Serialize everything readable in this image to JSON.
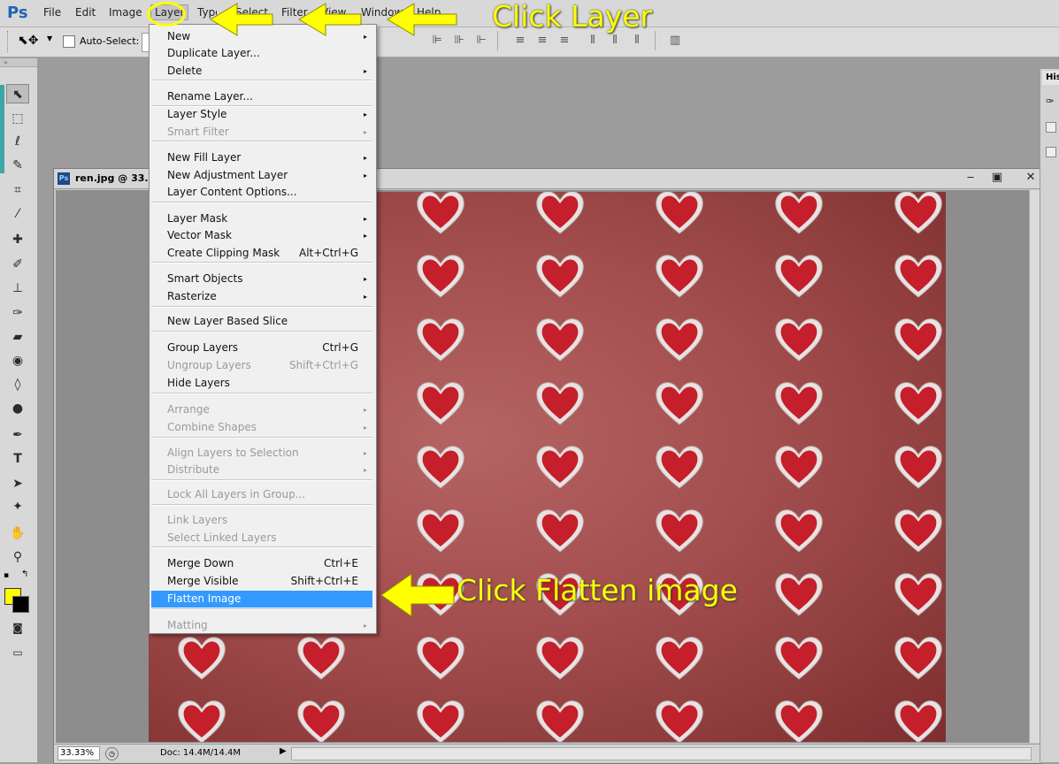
{
  "app": {
    "logo": "Ps"
  },
  "menubar": [
    "File",
    "Edit",
    "Image",
    "Layer",
    "Type",
    "Select",
    "Filter",
    "View",
    "Window",
    "Help"
  ],
  "options": {
    "auto_select": "Auto-Select:"
  },
  "document": {
    "title": "ren.jpg @ 33.3",
    "zoom": "33.33%",
    "doc_size": "Doc: 14.4M/14.4M"
  },
  "right_panel": {
    "tab": "His"
  },
  "layer_menu": {
    "items": [
      {
        "label": "New",
        "arrow": "▸",
        "disabled": false
      },
      {
        "label": "Duplicate Layer...",
        "disabled": false
      },
      {
        "label": "Delete",
        "arrow": "▸",
        "disabled": false
      },
      {
        "label": "Rename Layer...",
        "disabled": false
      },
      {
        "label": "Layer Style",
        "arrow": "▸",
        "disabled": false
      },
      {
        "label": "Smart Filter",
        "arrow": "▸",
        "disabled": true
      },
      {
        "label": "New Fill Layer",
        "arrow": "▸",
        "disabled": false
      },
      {
        "label": "New Adjustment Layer",
        "arrow": "▸",
        "disabled": false
      },
      {
        "label": "Layer Content Options...",
        "disabled": false
      },
      {
        "label": "Layer Mask",
        "arrow": "▸",
        "disabled": false
      },
      {
        "label": "Vector Mask",
        "arrow": "▸",
        "disabled": false
      },
      {
        "label": "Create Clipping Mask",
        "shortcut": "Alt+Ctrl+G",
        "disabled": false
      },
      {
        "label": "Smart Objects",
        "arrow": "▸",
        "disabled": false
      },
      {
        "label": "Rasterize",
        "arrow": "▸",
        "disabled": false
      },
      {
        "label": "New Layer Based Slice",
        "disabled": false
      },
      {
        "label": "Group Layers",
        "shortcut": "Ctrl+G",
        "disabled": false
      },
      {
        "label": "Ungroup Layers",
        "shortcut": "Shift+Ctrl+G",
        "disabled": true
      },
      {
        "label": "Hide Layers",
        "disabled": false
      },
      {
        "label": "Arrange",
        "arrow": "▸",
        "disabled": true
      },
      {
        "label": "Combine Shapes",
        "arrow": "▸",
        "disabled": true
      },
      {
        "label": "Align Layers to Selection",
        "arrow": "▸",
        "disabled": true
      },
      {
        "label": "Distribute",
        "arrow": "▸",
        "disabled": true
      },
      {
        "label": "Lock All Layers in Group...",
        "disabled": true
      },
      {
        "label": "Link Layers",
        "disabled": true
      },
      {
        "label": "Select Linked Layers",
        "disabled": true
      },
      {
        "label": "Merge Down",
        "shortcut": "Ctrl+E",
        "disabled": false
      },
      {
        "label": "Merge Visible",
        "shortcut": "Shift+Ctrl+E",
        "disabled": false
      },
      {
        "label": "Flatten Image",
        "disabled": false,
        "highlighted": true
      },
      {
        "label": "Matting",
        "arrow": "▸",
        "disabled": true
      }
    ]
  },
  "annotations": {
    "click_layer": "Click Layer",
    "click_flatten": "Click Flatten image"
  },
  "colors": {
    "foreground": "#ffff00",
    "background": "#000000",
    "highlight": "#3399ff",
    "annotation": "#ffff00"
  }
}
